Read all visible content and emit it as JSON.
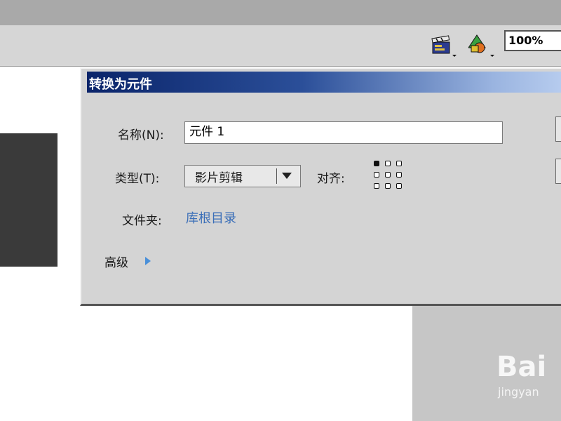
{
  "toolbar": {
    "zoom_value": "100%",
    "icons": [
      "edit-scene-icon",
      "edit-symbols-icon"
    ]
  },
  "dialog": {
    "title": "转换为元件",
    "name_label": "名称(N):",
    "name_value": "元件 1",
    "type_label": "类型(T):",
    "type_value": "影片剪辑",
    "align_label": "对齐:",
    "folder_label": "文件夹:",
    "folder_value": "库根目录",
    "advanced_label": "高级"
  },
  "watermark": {
    "text": "Bai",
    "subtext": "jingyan"
  },
  "colors": {
    "title_bar_start": "#0a246a",
    "title_bar_end": "#b8cdef",
    "dialog_bg": "#d4d4d4",
    "link": "#3a6eb8",
    "shape_fill": "#3a3a3a"
  }
}
